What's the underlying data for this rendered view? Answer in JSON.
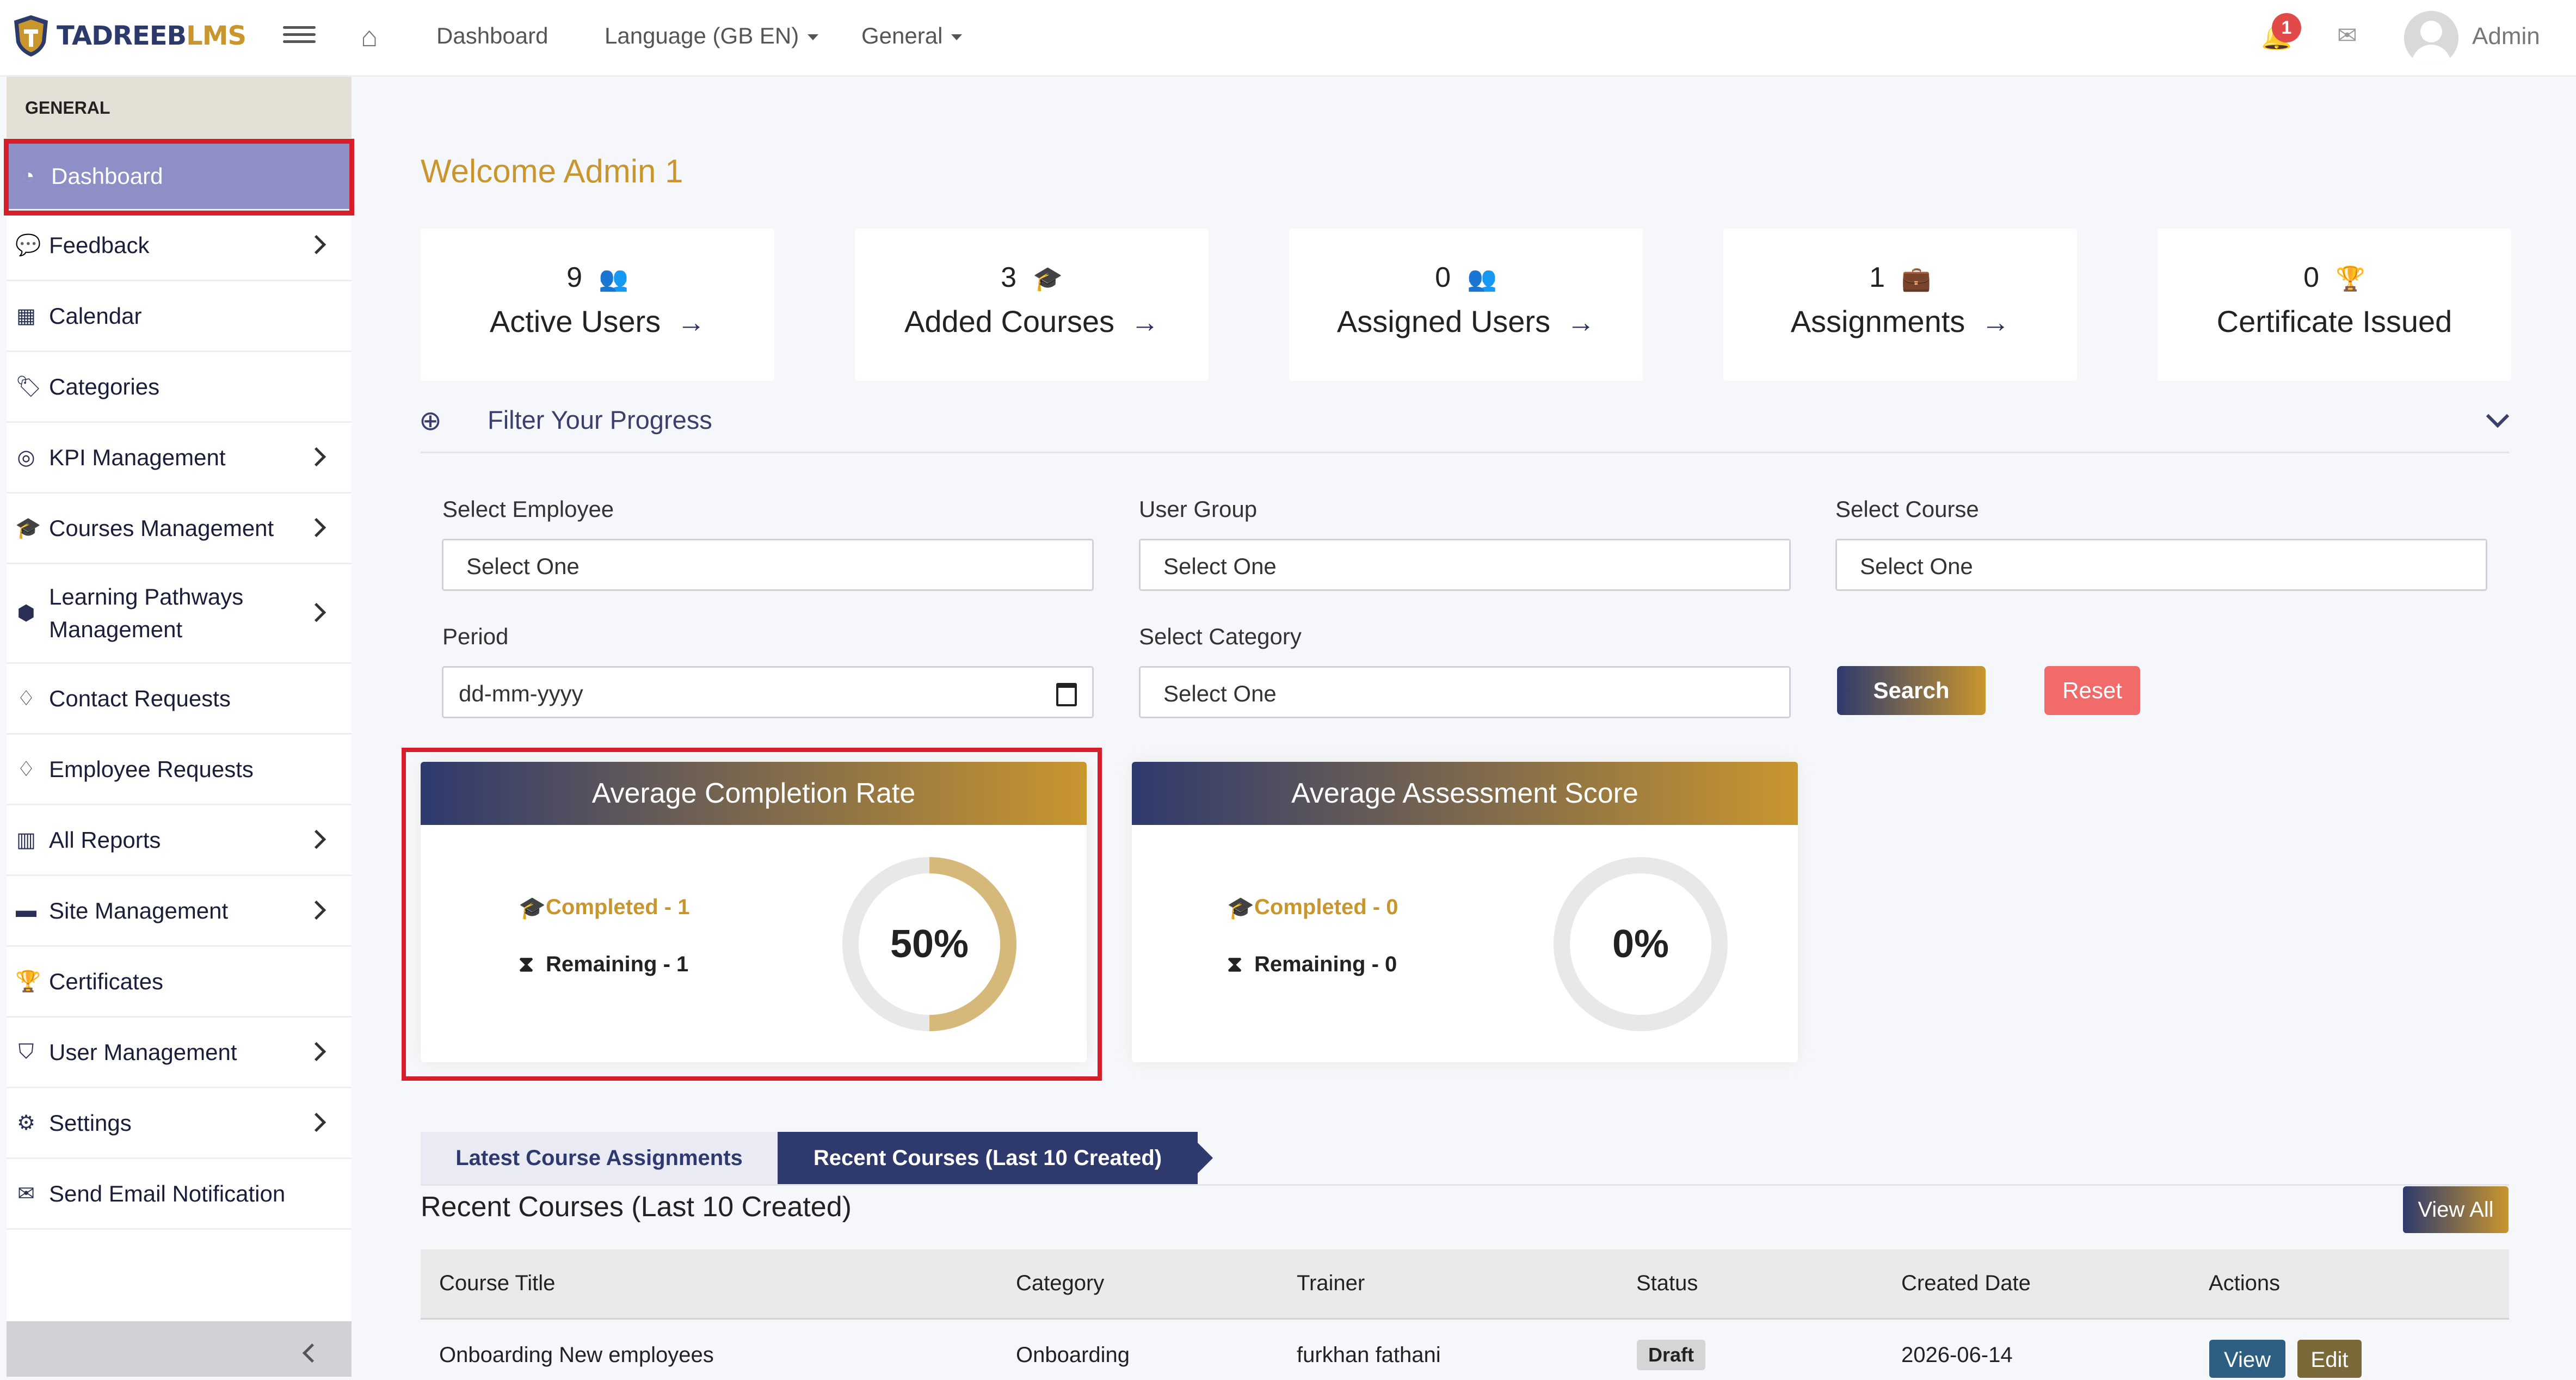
{
  "brand": {
    "part1": "TADREEB",
    "part2": "LMS"
  },
  "topnav": {
    "dashboard": "Dashboard",
    "language": "Language (GB EN)",
    "general": "General",
    "notif_count": "1",
    "user": "Admin"
  },
  "sidebar": {
    "section": "GENERAL",
    "items": [
      {
        "label": "Dashboard",
        "icon": "gauge-icon",
        "glyph": "◔",
        "chevron": false
      },
      {
        "label": "Feedback",
        "icon": "comments-icon",
        "glyph": "💬",
        "chevron": true
      },
      {
        "label": "Calendar",
        "icon": "calendar-icon",
        "glyph": "▦",
        "chevron": false
      },
      {
        "label": "Categories",
        "icon": "tags-icon",
        "glyph": "🏷",
        "chevron": false
      },
      {
        "label": "KPI Management",
        "icon": "target-icon",
        "glyph": "◎",
        "chevron": true
      },
      {
        "label": "Courses Management",
        "icon": "graduation-cap-icon",
        "glyph": "🎓",
        "chevron": true
      },
      {
        "label": "Learning Pathways Management",
        "icon": "puzzle-icon",
        "glyph": "⬢",
        "chevron": true
      },
      {
        "label": "Contact Requests",
        "icon": "handshake-icon",
        "glyph": "♢",
        "chevron": false
      },
      {
        "label": "Employee Requests",
        "icon": "handshake-icon",
        "glyph": "♢",
        "chevron": false
      },
      {
        "label": "All Reports",
        "icon": "bar-chart-icon",
        "glyph": "▥",
        "chevron": true
      },
      {
        "label": "Site Management",
        "icon": "folder-icon",
        "glyph": "▬",
        "chevron": true
      },
      {
        "label": "Certificates",
        "icon": "trophy-icon",
        "glyph": "🏆",
        "chevron": false
      },
      {
        "label": "User Management",
        "icon": "shield-icon",
        "glyph": "⛉",
        "chevron": true
      },
      {
        "label": "Settings",
        "icon": "gear-icon",
        "glyph": "⚙",
        "chevron": true
      },
      {
        "label": "Send Email Notification",
        "icon": "envelope-icon",
        "glyph": "✉",
        "chevron": false
      }
    ]
  },
  "welcome": "Welcome Admin 1",
  "stats": [
    {
      "value": "9",
      "label": "Active Users",
      "icon": "users-icon",
      "arrow": true
    },
    {
      "value": "3",
      "label": "Added Courses",
      "icon": "graduation-cap-icon",
      "arrow": true
    },
    {
      "value": "0",
      "label": "Assigned Users",
      "icon": "users-icon",
      "arrow": true
    },
    {
      "value": "1",
      "label": "Assignments",
      "icon": "briefcase-icon",
      "arrow": true
    },
    {
      "value": "0",
      "label": "Certificate Issued",
      "icon": "trophy-icon",
      "arrow": false
    }
  ],
  "filter": {
    "title": "Filter Your Progress",
    "select_employee": {
      "label": "Select Employee",
      "value": "Select One"
    },
    "user_group": {
      "label": "User Group",
      "value": "Select One"
    },
    "select_course": {
      "label": "Select Course",
      "value": "Select One"
    },
    "period": {
      "label": "Period",
      "value": "dd-mm-yyyy"
    },
    "select_category": {
      "label": "Select Category",
      "value": "Select One"
    },
    "search": "Search",
    "reset": "Reset"
  },
  "cards": [
    {
      "title": "Average Completion Rate",
      "completed": "Completed - 1",
      "remaining": "Remaining - 1",
      "percent": "50%",
      "fraction": 0.5
    },
    {
      "title": "Average Assessment Score",
      "completed": "Completed - 0",
      "remaining": "Remaining - 0",
      "percent": "0%",
      "fraction": 0
    }
  ],
  "tabs": [
    "Latest Course Assignments",
    "Recent Courses (Last 10 Created)"
  ],
  "recent": {
    "title": "Recent Courses (Last 10 Created)",
    "view_all": "View All",
    "columns": [
      "Course Title",
      "Category",
      "Trainer",
      "Status",
      "Created Date",
      "Actions"
    ],
    "rows": [
      {
        "title": "Onboarding New employees",
        "category": "Onboarding",
        "trainer": "furkhan fathani",
        "status": "Draft",
        "date": "2026-06-14",
        "view": "View",
        "edit": "Edit"
      }
    ]
  },
  "colors": {
    "brand_blue": "#2e3a6e",
    "brand_gold": "#c9962e",
    "active_item": "#8f8fc7",
    "highlight_red": "#d71f2b"
  }
}
